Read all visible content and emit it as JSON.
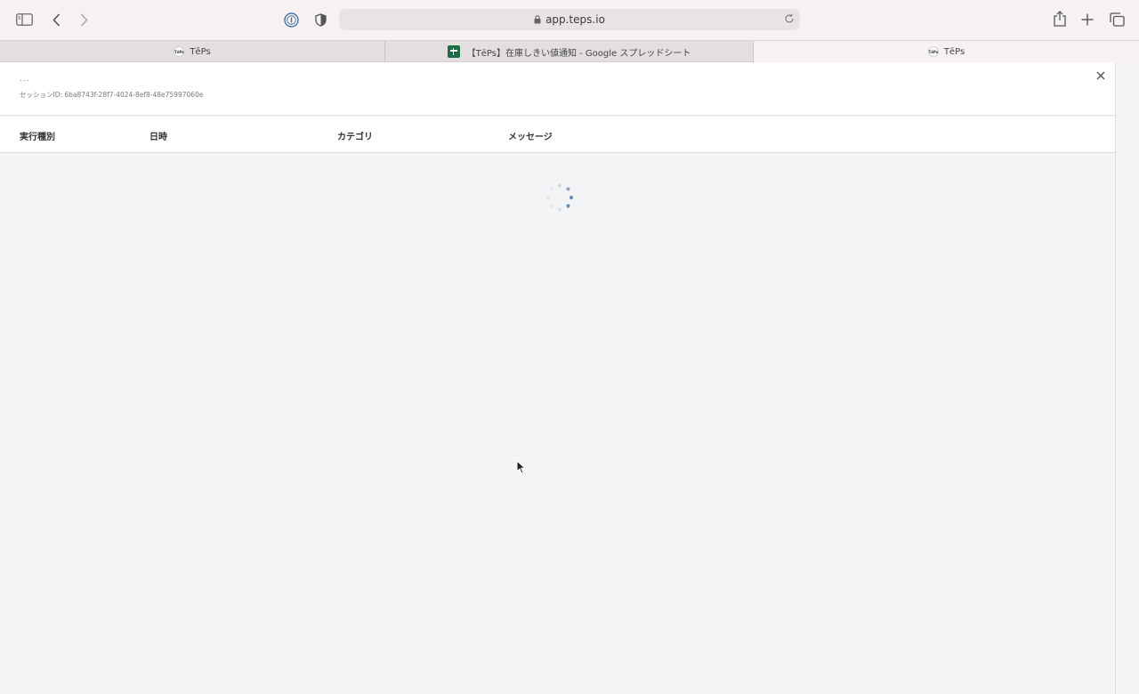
{
  "browser": {
    "url": "app.teps.io",
    "icons": [
      "sidebar-icon",
      "back-icon",
      "forward-icon",
      "password-manager-icon",
      "shield-icon",
      "lock-icon",
      "reload-icon",
      "share-icon",
      "new-tab-icon",
      "tabs-overview-icon"
    ]
  },
  "tabs": [
    {
      "title": "TēPs",
      "favicon": "teps-favicon",
      "active": false
    },
    {
      "title": "【TēPs】在庫しきい値通知 - Google スプレッドシート",
      "favicon": "google-sheets-icon",
      "active": false
    },
    {
      "title": "TēPs",
      "favicon": "teps-favicon",
      "active": true
    }
  ],
  "favicon_text": "TēPs",
  "panel": {
    "dots": "...",
    "session_label": "セッションID: 6ba8743f-28f7-4024-8ef8-48e75997060e"
  },
  "table": {
    "columns": [
      "実行種別",
      "日時",
      "カテゴリ",
      "メッセージ"
    ]
  },
  "colors": {
    "toolbar_bg": "#f6f2f2",
    "content_bg": "#f3f4f6",
    "spinner": "#6a8fb5",
    "sheets_green": "#1e6b45"
  }
}
